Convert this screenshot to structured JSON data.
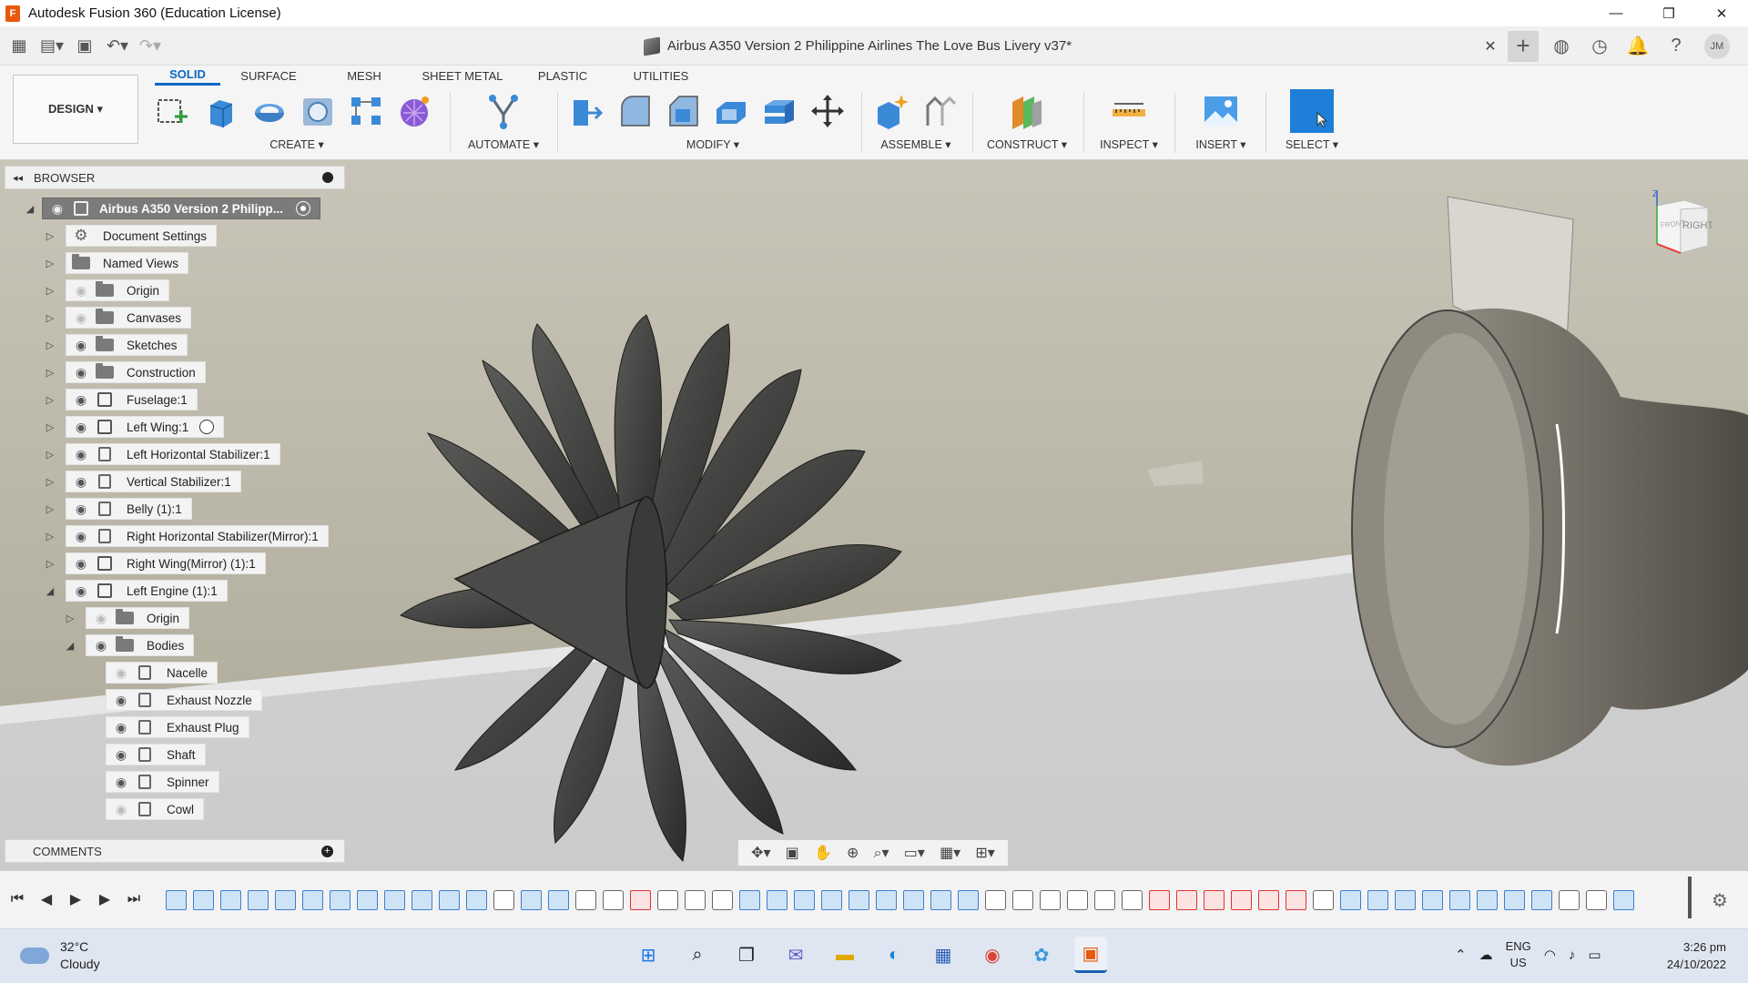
{
  "window": {
    "title": "Autodesk Fusion 360 (Education License)",
    "minimize": "—",
    "maximize": "❐",
    "close": "✕"
  },
  "document": {
    "title": "Airbus A350 Version 2 Philippine Airlines The Love Bus Livery v37*",
    "close": "✕"
  },
  "user": {
    "initials": "JM"
  },
  "ribbon": {
    "workspace": "DESIGN ▾",
    "tabs": [
      "SOLID",
      "SURFACE",
      "MESH",
      "SHEET METAL",
      "PLASTIC",
      "UTILITIES"
    ],
    "groups": {
      "create": "CREATE ▾",
      "automate": "AUTOMATE ▾",
      "modify": "MODIFY ▾",
      "assemble": "ASSEMBLE ▾",
      "construct": "CONSTRUCT ▾",
      "inspect": "INSPECT ▾",
      "insert": "INSERT ▾",
      "select": "SELECT ▾"
    }
  },
  "browser": {
    "title": "BROWSER",
    "root": "Airbus A350 Version 2 Philipp...",
    "items": [
      "Document Settings",
      "Named Views",
      "Origin",
      "Canvases",
      "Sketches",
      "Construction",
      "Fuselage:1",
      "Left Wing:1",
      "Left Horizontal Stabilizer:1",
      "Vertical Stabilizer:1",
      "Belly (1):1",
      "Right Horizontal Stabilizer(Mirror):1",
      "Right Wing(Mirror) (1):1",
      "Left Engine (1):1"
    ],
    "engine_children": [
      "Origin",
      "Bodies"
    ],
    "bodies": [
      "Nacelle",
      "Exhaust Nozzle",
      "Exhaust Plug",
      "Shaft",
      "Spinner",
      "Cowl"
    ]
  },
  "comments": {
    "title": "COMMENTS"
  },
  "viewcube": {
    "face": "RIGHT",
    "face_side": "FRONT",
    "axis": "Z"
  },
  "taskbar": {
    "temperature": "32°C",
    "condition": "Cloudy",
    "lang": "ENG",
    "region": "US",
    "time": "3:26 pm",
    "date": "24/10/2022"
  },
  "colors": {
    "accent": "#0b67c2",
    "logo": "#e8590c",
    "select_tool": "#1e7fd8"
  }
}
